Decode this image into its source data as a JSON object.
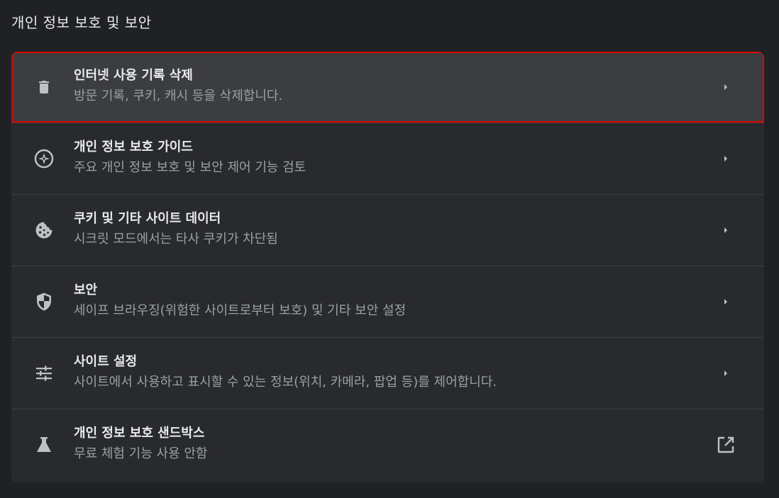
{
  "page": {
    "title": "개인 정보 보호 및 보안"
  },
  "colors": {
    "background": "#202124",
    "card": "#292a2d",
    "highlight_row": "#3c3d40",
    "highlight_border": "#e00000",
    "primary_text": "#e8eaed",
    "secondary_text": "#9aa0a6",
    "icon": "#bdc1c6"
  },
  "rows": [
    {
      "icon": "trash-icon",
      "title": "인터넷 사용 기록 삭제",
      "subtitle": "방문 기록, 쿠키, 캐시 등을 삭제합니다.",
      "action_icon": "chevron-right-icon"
    },
    {
      "icon": "compass-icon",
      "title": "개인 정보 보호 가이드",
      "subtitle": "주요 개인 정보 보호 및 보안 제어 기능 검토",
      "action_icon": "chevron-right-icon"
    },
    {
      "icon": "cookie-icon",
      "title": "쿠키 및 기타 사이트 데이터",
      "subtitle": "시크릿 모드에서는 타사 쿠키가 차단됨",
      "action_icon": "chevron-right-icon"
    },
    {
      "icon": "shield-icon",
      "title": "보안",
      "subtitle": "세이프 브라우징(위험한 사이트로부터 보호) 및 기타 보안 설정",
      "action_icon": "chevron-right-icon"
    },
    {
      "icon": "sliders-icon",
      "title": "사이트 설정",
      "subtitle": "사이트에서 사용하고 표시할 수 있는 정보(위치, 카메라, 팝업 등)를 제어합니다.",
      "action_icon": "chevron-right-icon"
    },
    {
      "icon": "flask-icon",
      "title": "개인 정보 보호 샌드박스",
      "subtitle": "무료 체험 기능 사용 안함",
      "action_icon": "open-in-new-icon"
    }
  ]
}
